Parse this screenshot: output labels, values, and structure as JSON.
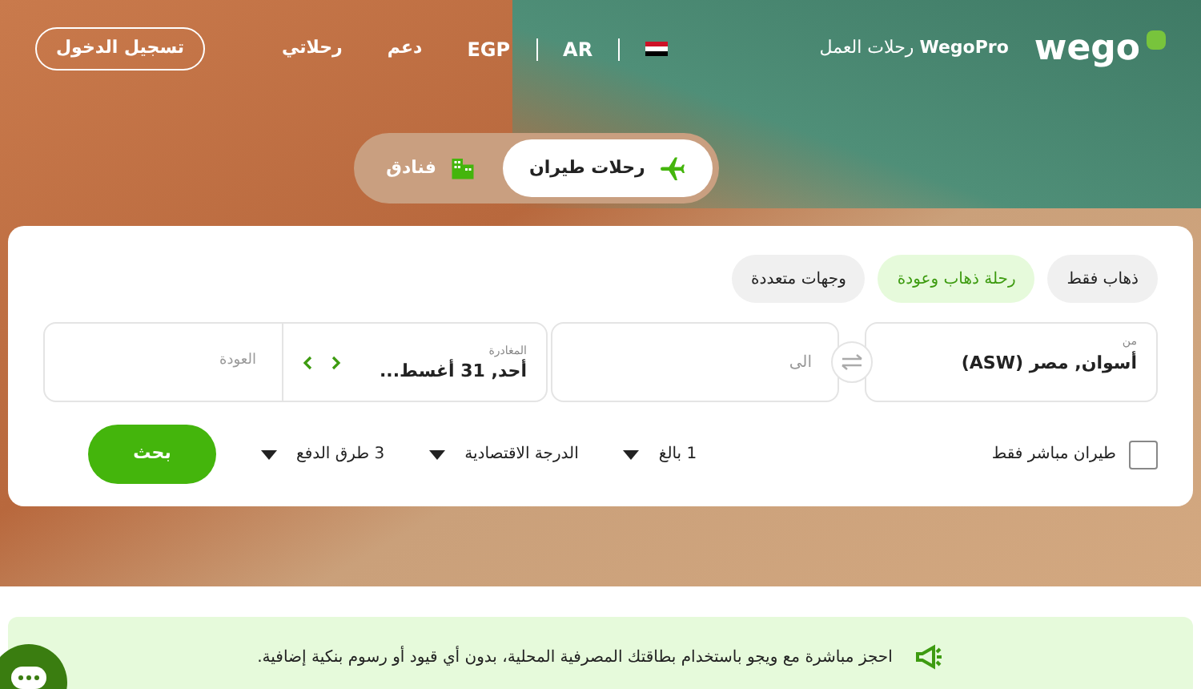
{
  "header": {
    "logo": "wego",
    "business_brand": "WegoPro",
    "business_label": "رحلات العمل",
    "language": "AR",
    "currency": "EGP",
    "support": "دعم",
    "my_trips": "رحلاتي",
    "login": "تسجيل الدخول"
  },
  "product_tabs": [
    {
      "kind": "flights",
      "label": "رحلات طيران",
      "selected": true
    },
    {
      "kind": "hotels",
      "label": "فنادق",
      "selected": false
    }
  ],
  "trip_types": [
    {
      "label": "ذهاب فقط",
      "selected": false
    },
    {
      "label": "رحلة ذهاب وعودة",
      "selected": true
    },
    {
      "label": "وجهات متعددة",
      "selected": false
    }
  ],
  "from": {
    "label": "من",
    "value": "أسوان, مصر (ASW)"
  },
  "to": {
    "placeholder": "الى"
  },
  "departure": {
    "label": "المغادرة",
    "value": "أحد, 31 أغسط..."
  },
  "return": {
    "placeholder": "العودة"
  },
  "direct_only": {
    "label": "طيران مباشر فقط",
    "checked": false
  },
  "dropdowns": [
    "1 بالغ",
    "الدرجة الاقتصادية",
    "3 طرق الدفع"
  ],
  "search_button": "بحث",
  "banner": "احجز مباشرة مع ويجو باستخدام بطاقتك المصرفية المحلية، بدون أي قيود أو رسوم بنكية إضافية."
}
